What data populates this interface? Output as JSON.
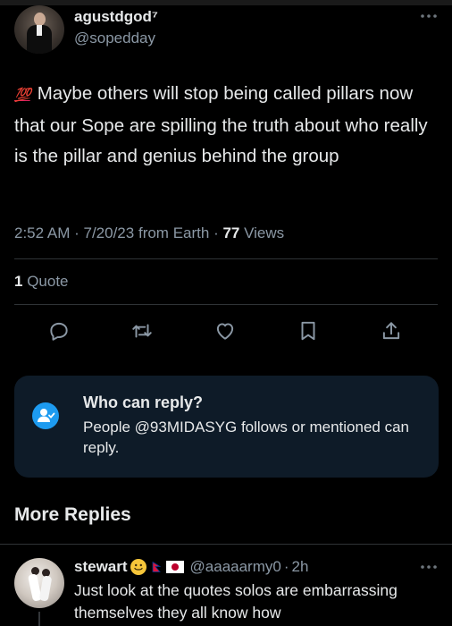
{
  "post": {
    "display_name": "agustdgod⁷",
    "handle": "@sopedday",
    "emoji": "💯",
    "text": "Maybe others will stop being called pillars now that our Sope are spilling the truth about who really is the pillar and genius behind the group",
    "time": "2:52 AM",
    "date": "7/20/23",
    "source": "from Earth",
    "views_count": "77",
    "views_label": "Views",
    "quote_count": "1",
    "quote_label": "Quote"
  },
  "actions": [
    {
      "icon": "reply-icon"
    },
    {
      "icon": "repost-icon"
    },
    {
      "icon": "like-icon"
    },
    {
      "icon": "bookmark-icon"
    },
    {
      "icon": "share-icon"
    }
  ],
  "reply_restriction": {
    "title": "Who can reply?",
    "description": "People @93MIDASYG follows or mentioned can reply."
  },
  "more_replies": {
    "title": "More Replies"
  },
  "reply": {
    "name": "stewart",
    "handle": "@aaaaarmy0",
    "time": "2h",
    "text": "Just look at the quotes solos are embarrassing themselves they all know how"
  },
  "colors": {
    "background": "#000000",
    "text": "#e7e9ea",
    "secondary": "#8b98a5",
    "accent": "#1d9bf0",
    "card": "#0e1b28"
  }
}
